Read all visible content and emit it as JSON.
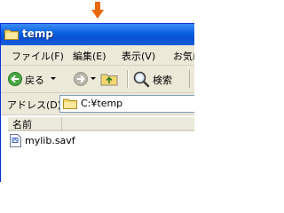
{
  "window": {
    "title": "temp"
  },
  "menu": {
    "items": [
      {
        "label": "ファイル(F)"
      },
      {
        "label": "編集(E)"
      },
      {
        "label": "表示(V)"
      },
      {
        "label": "お気に"
      }
    ]
  },
  "toolbar": {
    "back_label": "戻る",
    "search_label": "検索"
  },
  "address": {
    "label": "アドレス(D)",
    "value": "C:¥temp"
  },
  "list": {
    "column_name": "名前",
    "files": [
      {
        "name": "mylib.savf",
        "icon": "document-icon"
      }
    ]
  },
  "colors": {
    "arrow": "#e8690a",
    "titlebar": "#0a5fe0",
    "window_bg": "#ece9d8"
  }
}
